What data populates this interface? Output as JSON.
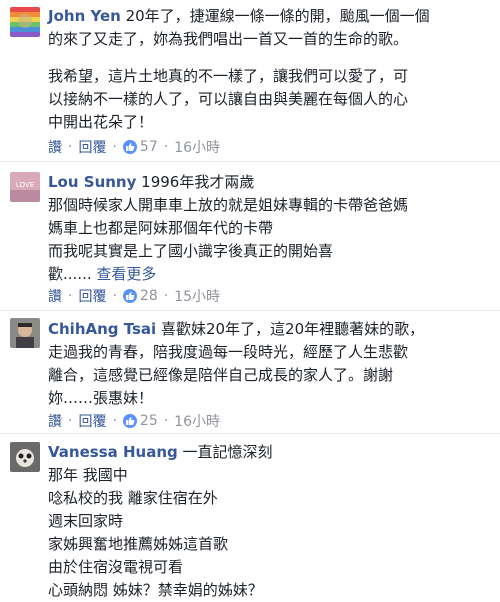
{
  "comments": [
    {
      "name": "John Yen",
      "lines": [
        "20年了，捷運線一條一條的開，颱風一個一個",
        "的來了又走了，妳為我們唱出一首又一首的生命的歌。",
        "",
        "我希望，這片土地真的不一樣了，讓我們可以愛了，可",
        "以接納不一樣的人了，可以讓自由與美麗在每個人的心",
        "中開出花朵了！"
      ],
      "actions": {
        "like": "讚",
        "reply": "回覆",
        "likes": "57",
        "time": "16小時"
      }
    },
    {
      "name": "Lou Sunny",
      "lines": [
        "1996年我才兩歲",
        "那個時候家人開車車上放的就是姐妹專輯的卡帶爸爸媽",
        "媽車上也都是阿妹那個年代的卡帶",
        "而我呢其實是上了國小識字後真正的開始喜",
        "歡......"
      ],
      "see_more": "查看更多",
      "actions": {
        "like": "讚",
        "reply": "回覆",
        "likes": "28",
        "time": "15小時"
      }
    },
    {
      "name": "ChihAng Tsai",
      "lines": [
        "喜歡妹20年了，這20年裡聽著妹的歌，",
        "走過我的青春，陪我度過每一段時光，經歷了人生悲歡",
        "離合，這感覺已經像是陪伴自己成長的家人了。謝謝",
        "妳……張惠妹！"
      ],
      "actions": {
        "like": "讚",
        "reply": "回覆",
        "likes": "25",
        "time": "16小時"
      }
    },
    {
      "name": "Vanessa Huang",
      "lines": [
        "一直記憶深刻",
        "那年 我國中",
        "唸私校的我 離家住宿在外",
        "週末回家時",
        "家姊興奮地推薦姊姊這首歌",
        "由於住宿沒電視可看",
        "心頭納悶 姊妹？禁幸娟的姊妹？"
      ]
    }
  ],
  "colors": {
    "name": "#365899",
    "meta": "#90949c",
    "like_badge": "#5890ff",
    "text": "#1d2129"
  },
  "icons": {
    "like": "thumbs-up-icon"
  }
}
